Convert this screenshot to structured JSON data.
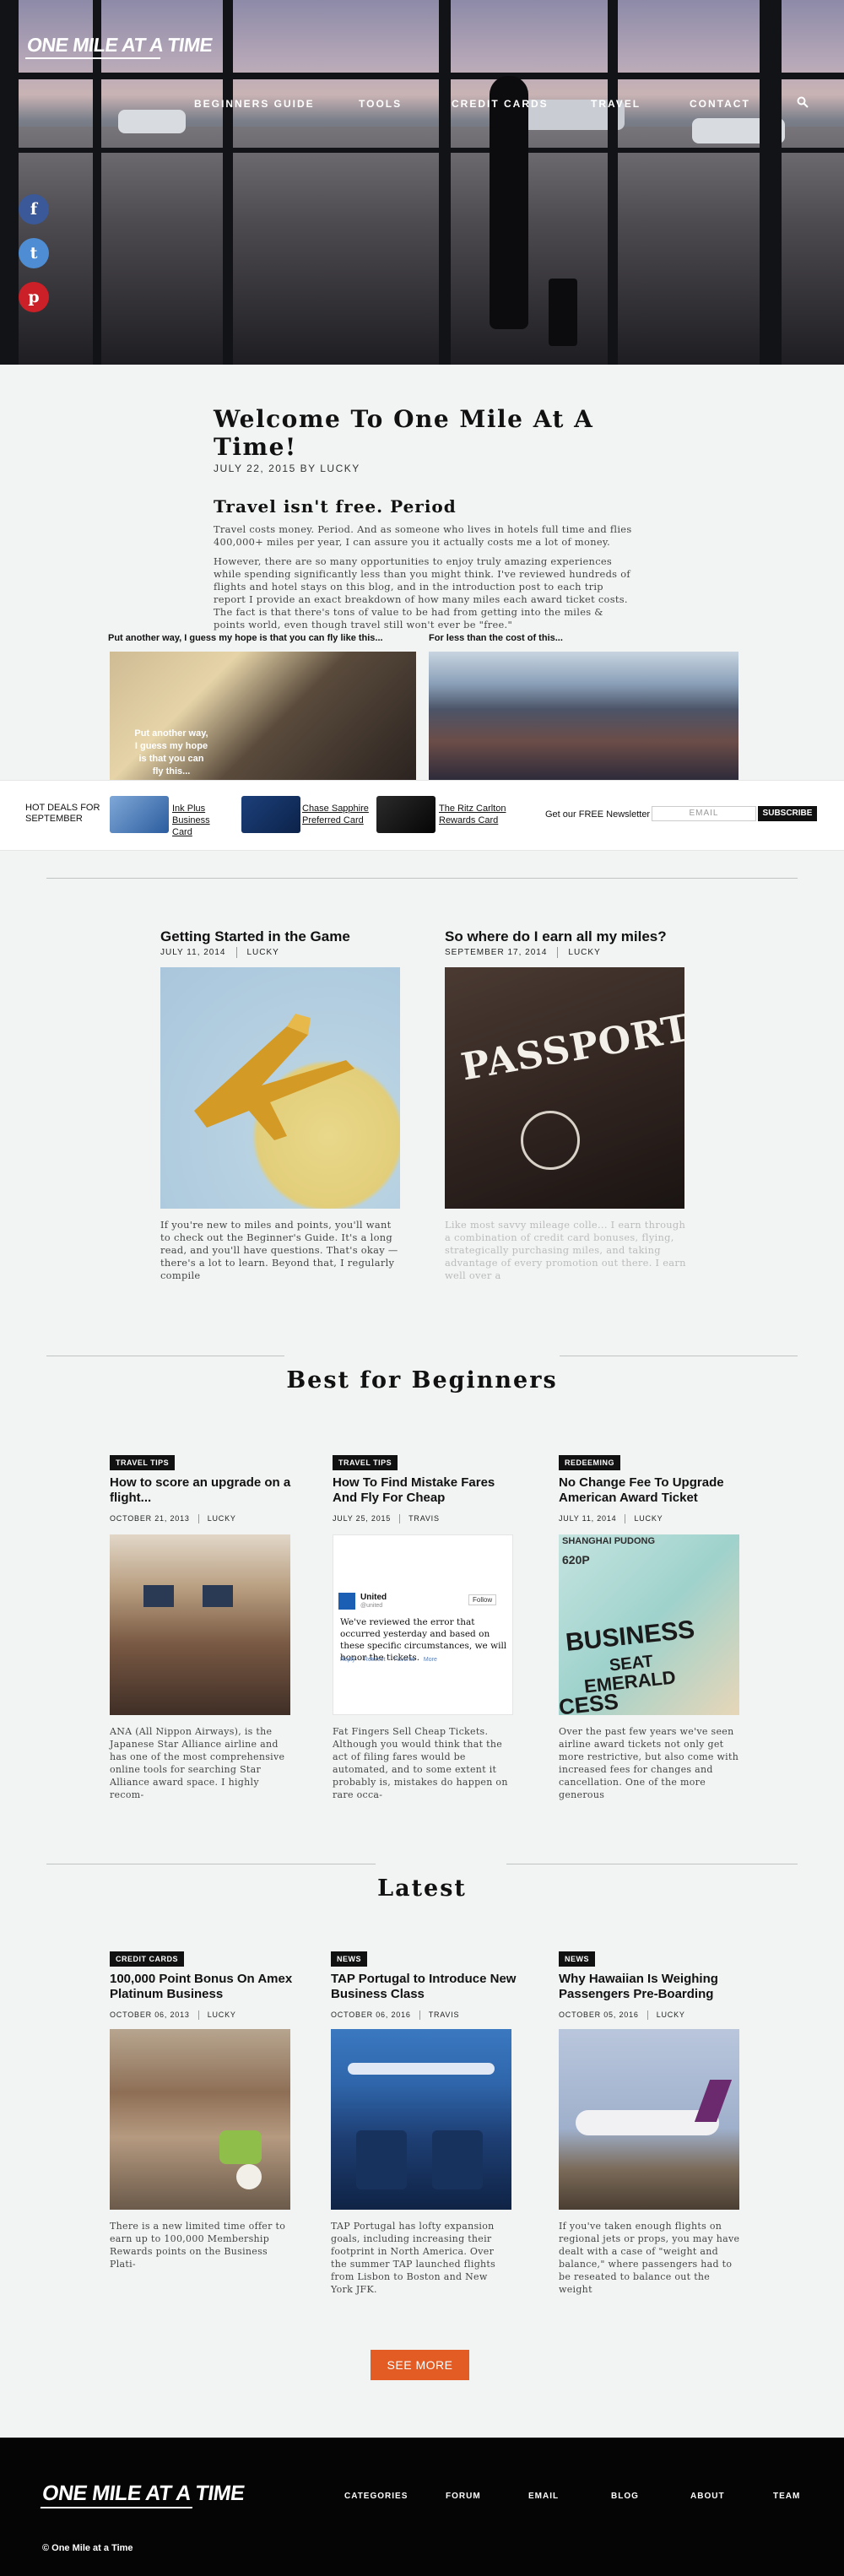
{
  "header": {
    "logo": "ONE MILE AT A TIME",
    "nav": [
      "BEGINNERS GUIDE",
      "TOOLS",
      "CREDIT CARDS",
      "TRAVEL",
      "CONTACT"
    ]
  },
  "social": {
    "facebook": "f",
    "twitter": "t",
    "pinterest": "p"
  },
  "welcome": {
    "title": "Welcome To One Mile At A Time!",
    "date": "JULY 22, 2015 BY LUCKY",
    "subtitle": "Travel isn't free. Period",
    "p1": "Travel costs money. Period. And as someone who lives in hotels full time and flies 400,000+ miles per year, I can assure you it actually costs me a lot of money.",
    "p2": "However, there are so many opportunities to enjoy truly amazing experiences while spending significantly less than you might think. I've reviewed hundreds of flights and hotel stays on this blog, and in the introduction post to each trip report I provide an exact breakdown of how many miles each award ticket costs. The fact is that there's tons of value to be had from getting into the miles & points world, even though travel still won't ever be \"free.\""
  },
  "compare": {
    "left_caption": "Put another way, I guess my hope is that you can fly like this...",
    "right_caption": "For less than the cost of this...",
    "overlay": "Put another way, I guess my hope is that you can fly this..."
  },
  "deals": {
    "label": "HOT DEALS FOR SEPTEMBER",
    "cards": [
      "Ink Plus Business Card",
      "Chase Sapphire Preferred Card",
      "The Ritz Carlton Rewards Card"
    ],
    "newsletter": "Get our FREE Newsletter",
    "email_placeholder": "EMAIL",
    "subscribe": "SUBSCRIBE"
  },
  "guides": [
    {
      "title": "Getting Started in the Game",
      "date": "JULY 11, 2014",
      "author": "LUCKY",
      "text": "If you're new to miles and points, you'll want to check out the Beginner's Guide. It's a long read, and you'll have questions. That's okay — there's a lot to learn. Beyond that, I regularly compile"
    },
    {
      "title": "So where do I earn all my miles?",
      "date": "SEPTEMBER 17, 2014",
      "author": "LUCKY",
      "text": "Like most savvy mileage colle... I earn through a combination of credit card bonuses, flying, strategically purchasing miles, and taking advantage of every promotion out there. I earn well over a",
      "passport": "PASSPORT"
    }
  ],
  "beginners": {
    "heading": "Best for Beginners",
    "items": [
      {
        "tag": "TRAVEL TIPS",
        "title": "How to score an upgrade on a flight...",
        "date": "OCTOBER 21, 2013",
        "author": "LUCKY",
        "text": "ANA (All Nippon Airways), is the Japanese Star Alliance airline and has one of the most comprehensive online tools for searching Star Alliance award space. I highly recom-"
      },
      {
        "tag": "TRAVEL TIPS",
        "title": "How To Find Mistake Fares And Fly For Cheap",
        "date": "JULY 25, 2015",
        "author": "TRAVIS",
        "text": "Fat Fingers Sell Cheap Tickets. Although you would think that the act of filing fares would be automated, and to some extent it probably is, mistakes do happen on rare occa-",
        "tweet_name": "United",
        "tweet_handle": "@united",
        "tweet_follow": "Follow",
        "tweet_body": "We've reviewed the error that occurred yesterday and based on these specific circumstances, we will honor the tickets.",
        "tweet_actions": [
          "Reply",
          "Retweet",
          "Favorite",
          "More"
        ]
      },
      {
        "tag": "REDEEMING",
        "title": "No Change Fee To Upgrade American Award Ticket",
        "date": "JULY 11, 2014",
        "author": "LUCKY",
        "text": "Over the past few years we've seen airline award tickets not only get more restrictive, but also come with increased fees for changes and cancellation. One of the more generous",
        "ticket_words": [
          "SHANGHAI PUDONG",
          "620P",
          "BUSINESS",
          "SEAT",
          "EMERALD",
          "CESS"
        ]
      }
    ]
  },
  "latest": {
    "heading": "Latest",
    "items": [
      {
        "tag": "CREDIT CARDS",
        "title": "100,000 Point Bonus On Amex Platinum Business",
        "date": "OCTOBER 06, 2013",
        "author": "LUCKY",
        "text": "There is a new limited time offer to earn up to 100,000 Membership Rewards points on the Business Plati-"
      },
      {
        "tag": "NEWS",
        "title": "TAP Portugal to Introduce New Business Class",
        "date": "OCTOBER 06, 2016",
        "author": "TRAVIS",
        "text": "TAP Portugal has lofty expansion goals, including increasing their footprint in North America. Over the summer TAP launched flights from Lisbon to Boston and New York JFK."
      },
      {
        "tag": "NEWS",
        "title": "Why Hawaiian Is Weighing Passengers Pre-Boarding",
        "date": "OCTOBER 05, 2016",
        "author": "LUCKY",
        "text": "If you've taken enough flights on regional jets or props, you may have dealt with a case of \"weight and balance,\" where passengers had to be reseated to balance out the weight"
      }
    ],
    "see_more": "SEE MORE"
  },
  "footer": {
    "logo": "ONE MILE AT A TIME",
    "nav": [
      "CATEGORIES",
      "FORUM",
      "EMAIL",
      "BLOG",
      "ABOUT",
      "TEAM"
    ],
    "copyright": "© One Mile at a Time"
  },
  "colors": {
    "accent": "#e25c24",
    "dark": "#111111",
    "facebook": "#3b5998",
    "twitter": "#4e8dd3",
    "pinterest": "#cb2027"
  }
}
